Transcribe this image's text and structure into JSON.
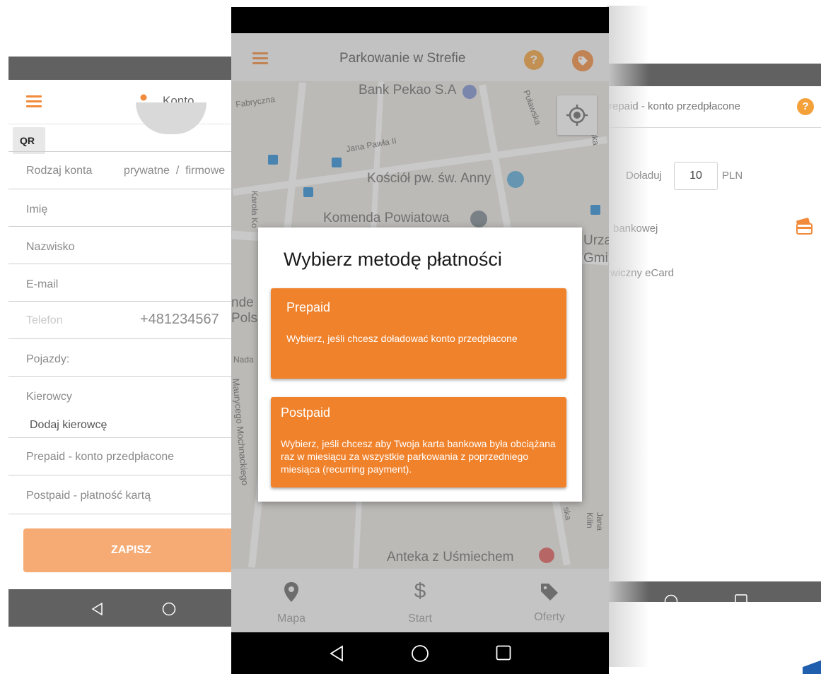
{
  "left_screen": {
    "app_title": "Konto",
    "qr_label": "QR",
    "fields": [
      {
        "label": "Rodzaj konta",
        "value": "prywatne  /  firmowe"
      },
      {
        "label": "Imię"
      },
      {
        "label": "Nazwisko"
      },
      {
        "label": "E-mail"
      },
      {
        "label": "Telefon",
        "value": "+481234567"
      },
      {
        "label": "Pojazdy:"
      },
      {
        "label": "Kierowcy",
        "sub": "Dodaj kierowcę"
      },
      {
        "label": "Prepaid - konto przedpłacone"
      },
      {
        "label": "Postpaid - płatność kartą"
      }
    ],
    "save_label": "ZAPISZ"
  },
  "center_screen": {
    "app_title": "Parkowanie w Strefie",
    "help_icon_char": "?",
    "map_labels": {
      "bank": "Bank Pekao S.A",
      "church": "Kościół pw. św. Anny",
      "police": "Komenda Powiatowa",
      "street_pawla": "Jana Pawła II",
      "street_fabryczna": "Fabryczna",
      "street_pulawska": "Puławska",
      "street_karola": "Karola Ko",
      "street_mochnackiego": "Maurycego Mochnackiego",
      "anteka": "Anteka z Uśmiechem",
      "partial_urz": "Urzą",
      "partial_gmi": "Gmi",
      "partial_nde": "nde",
      "partial_pols": "Pols",
      "partial_nada": "Nada",
      "partial_jana_kilin": "Jana Kilin",
      "partial_ska": "ska",
      "partial_wska": "wska"
    },
    "bottom_nav": [
      {
        "label": "Mapa",
        "icon": "map-pin-icon"
      },
      {
        "label": "Start",
        "icon": "dollar-icon"
      },
      {
        "label": "Oferty",
        "icon": "tag-icon"
      }
    ],
    "dialog": {
      "title": "Wybierz metodę płatności",
      "options": [
        {
          "title": "Prepaid",
          "description": "Wybierz, jeśli chcesz doładować konto przedpłacone"
        },
        {
          "title": "Postpaid",
          "description": "Wybierz, jeśli chcesz aby Twoja karta bankowa była obciążana raz w miesiącu za wszystkie parkowania z poprzedniego miesiąca (recurring payment)."
        }
      ]
    }
  },
  "right_screen": {
    "app_title": "repaid - konto przedpłacone",
    "help_icon_char": "?",
    "topup_label": "Doładuj",
    "topup_value": "10",
    "currency": "PLN",
    "bank_label": "bankowej",
    "ecard_label": "wiczny eCard"
  },
  "colors": {
    "accent": "#f0822c",
    "accent_light": "#f6ab74",
    "dark_bar": "#616161"
  }
}
